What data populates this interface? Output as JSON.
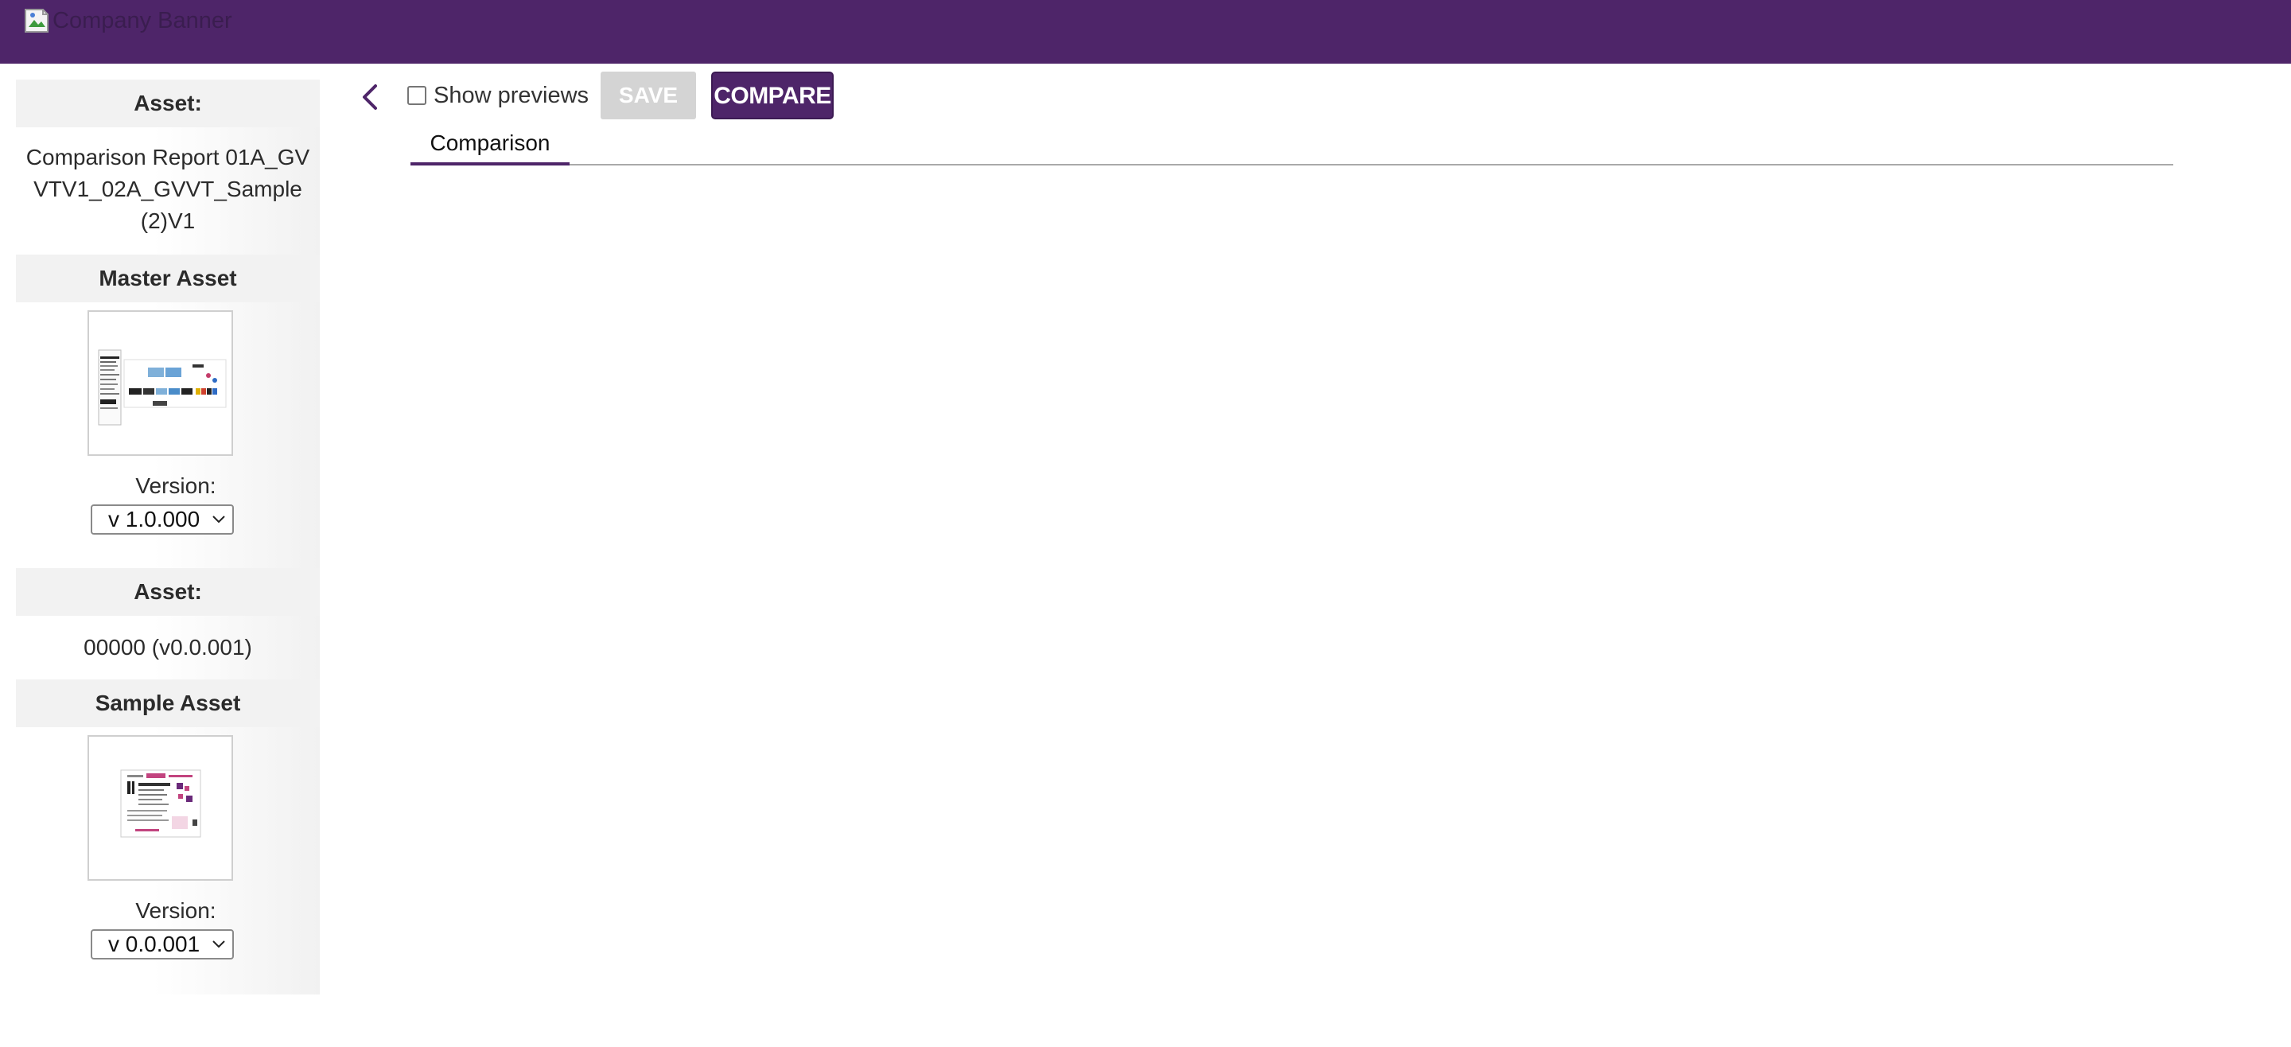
{
  "banner": {
    "alt_text": "Company Banner",
    "color": "#4e2569"
  },
  "sidebar": {
    "master": {
      "asset_header": "Asset:",
      "asset_name": "Comparison Report 01A_GVVTV1_02A_GVVT_Sample (2)V1",
      "section_title": "Master Asset",
      "version_label": "Version:",
      "version_value": "v 1.0.000"
    },
    "sample": {
      "asset_header": "Asset:",
      "asset_name": "00000 (v0.0.001)",
      "section_title": "Sample Asset",
      "version_label": "Version:",
      "version_value": "v 0.0.001"
    }
  },
  "toolbar": {
    "back_icon": "chevron-left-icon",
    "show_previews_label": "Show previews",
    "show_previews_checked": false,
    "save_label": "SAVE",
    "save_enabled": false,
    "compare_label": "COMPARE"
  },
  "tabs": [
    {
      "label": "Comparison",
      "active": true
    }
  ],
  "colors": {
    "accent": "#4e2569",
    "disabled_button": "#d4d4d4"
  }
}
